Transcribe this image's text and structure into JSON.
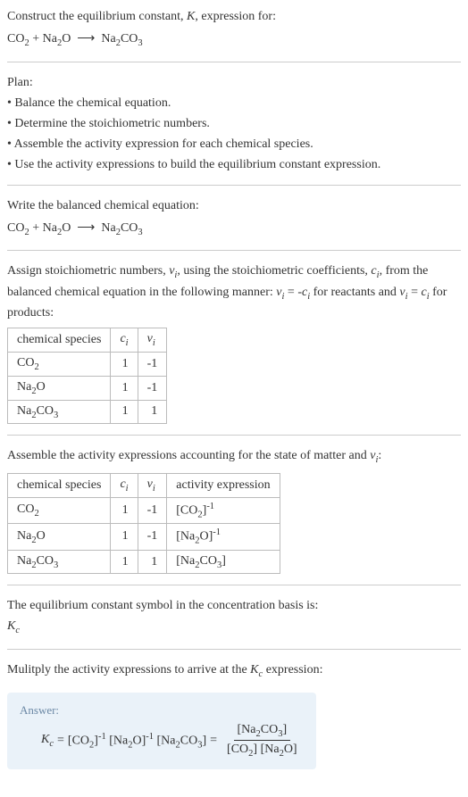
{
  "intro": {
    "line1_pre": "Construct the equilibrium constant, ",
    "line1_k": "K",
    "line1_post": ", expression for:",
    "equation_html": "CO<sub>2</sub> + Na<sub>2</sub>O&nbsp;&nbsp;⟶&nbsp;&nbsp;Na<sub>2</sub>CO<sub>3</sub>"
  },
  "plan": {
    "heading": "Plan:",
    "items": [
      "• Balance the chemical equation.",
      "• Determine the stoichiometric numbers.",
      "• Assemble the activity expression for each chemical species.",
      "• Use the activity expressions to build the equilibrium constant expression."
    ]
  },
  "balanced": {
    "heading": "Write the balanced chemical equation:",
    "equation_html": "CO<sub>2</sub> + Na<sub>2</sub>O&nbsp;&nbsp;⟶&nbsp;&nbsp;Na<sub>2</sub>CO<sub>3</sub>"
  },
  "stoich": {
    "text_html": "Assign stoichiometric numbers, <i>ν<sub>i</sub></i>, using the stoichiometric coefficients, <i>c<sub>i</sub></i>, from the balanced chemical equation in the following manner: <i>ν<sub>i</sub></i> = -<i>c<sub>i</sub></i> for reactants and <i>ν<sub>i</sub></i> = <i>c<sub>i</sub></i> for products:",
    "headers": {
      "species": "chemical species",
      "ci_html": "<i>c<sub>i</sub></i>",
      "vi_html": "<i>ν<sub>i</sub></i>"
    },
    "rows": [
      {
        "species_html": "CO<sub>2</sub>",
        "ci": "1",
        "vi": "-1"
      },
      {
        "species_html": "Na<sub>2</sub>O",
        "ci": "1",
        "vi": "-1"
      },
      {
        "species_html": "Na<sub>2</sub>CO<sub>3</sub>",
        "ci": "1",
        "vi": "1"
      }
    ]
  },
  "activity": {
    "text_html": "Assemble the activity expressions accounting for the state of matter and <i>ν<sub>i</sub></i>:",
    "headers": {
      "species": "chemical species",
      "ci_html": "<i>c<sub>i</sub></i>",
      "vi_html": "<i>ν<sub>i</sub></i>",
      "activity": "activity expression"
    },
    "rows": [
      {
        "species_html": "CO<sub>2</sub>",
        "ci": "1",
        "vi": "-1",
        "act_html": "[CO<sub>2</sub>]<sup>-1</sup>"
      },
      {
        "species_html": "Na<sub>2</sub>O",
        "ci": "1",
        "vi": "-1",
        "act_html": "[Na<sub>2</sub>O]<sup>-1</sup>"
      },
      {
        "species_html": "Na<sub>2</sub>CO<sub>3</sub>",
        "ci": "1",
        "vi": "1",
        "act_html": "[Na<sub>2</sub>CO<sub>3</sub>]"
      }
    ]
  },
  "symbol": {
    "text": "The equilibrium constant symbol in the concentration basis is:",
    "kc_html": "<i>K<sub>c</sub></i>"
  },
  "multiply": {
    "text_html": "Mulitply the activity expressions to arrive at the <i>K<sub>c</sub></i> expression:"
  },
  "answer": {
    "label": "Answer:",
    "kc_html": "<i>K<sub>c</sub></i>",
    "eq": " = ",
    "lhs_html": "[CO<sub>2</sub>]<sup>-1</sup> [Na<sub>2</sub>O]<sup>-1</sup> [Na<sub>2</sub>CO<sub>3</sub>]",
    "frac_num_html": "[Na<sub>2</sub>CO<sub>3</sub>]",
    "frac_den_html": "[CO<sub>2</sub>] [Na<sub>2</sub>O]"
  }
}
